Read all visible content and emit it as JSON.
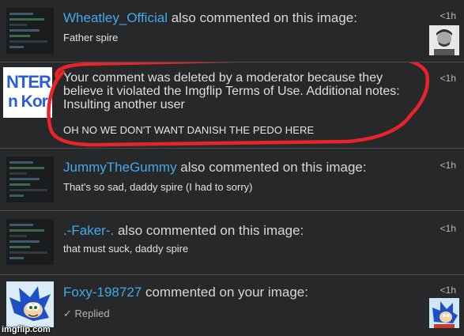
{
  "notifications": [
    {
      "username": "Wheatley_Official",
      "action": " also commented on this image:",
      "snippet": "Father spire",
      "time": "<1h"
    },
    {
      "thumbnail_text": {
        "line1": "NTER",
        "line2": "n Kor"
      },
      "body": "Your comment was deleted by a moderator because they believe it violated the Imgflip Terms of Use. Additional notes: Insulting another user",
      "note": "OH NO WE DON'T WANT DANISH THE PEDO HERE",
      "time": "<1h"
    },
    {
      "username": "JummyTheGummy",
      "action": " also commented on this image:",
      "snippet": "That's so sad, daddy spire (I had to sorry)",
      "time": "<1h"
    },
    {
      "username": ".-Faker-.",
      "action": " also commented on this image:",
      "snippet": "that must suck, daddy spire",
      "time": "<1h"
    },
    {
      "username": "Foxy-198727",
      "action": " commented on your image:",
      "status_check": "✓",
      "status": "Replied",
      "time": "<1h"
    }
  ],
  "watermark": "imgflip.com",
  "colors": {
    "background": "#27282a",
    "username": "#45a8e8",
    "text": "#d7d7d7",
    "highlight_circle": "#e8242a"
  }
}
